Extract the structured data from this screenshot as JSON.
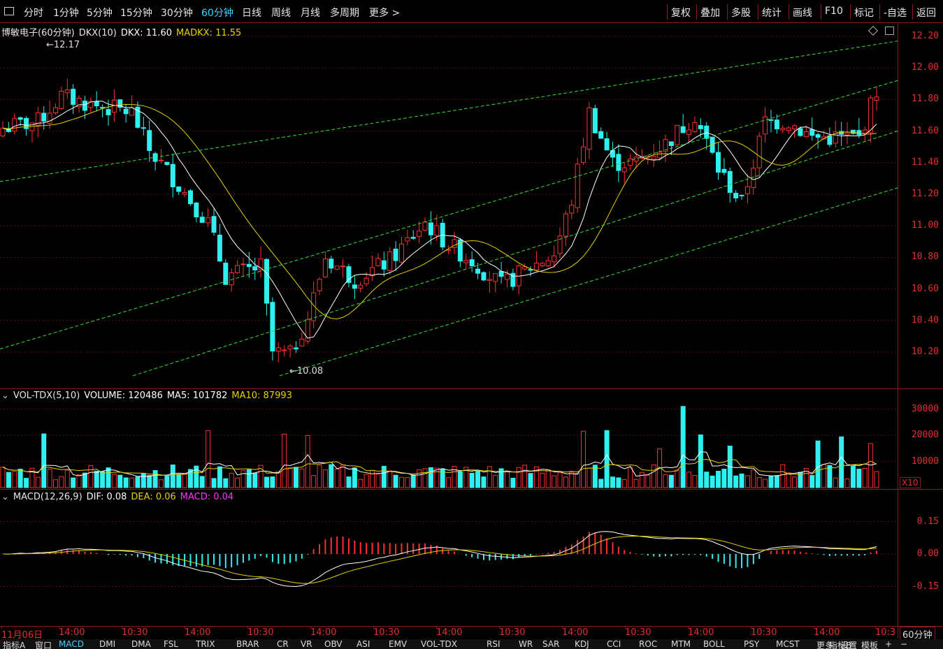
{
  "toolbar": {
    "left_items": [
      "分时",
      "1分钟",
      "5分钟",
      "15分钟",
      "30分钟",
      "60分钟",
      "日线",
      "周线",
      "月线",
      "多周期",
      "更多 >"
    ],
    "active": "60分钟",
    "right_items": [
      "复权",
      "叠加",
      "多股",
      "统计",
      "画线",
      "F10",
      "标记",
      "-自选",
      "返回"
    ]
  },
  "main_panel": {
    "stock_name": "博敏电子(60分钟)",
    "indicator_name": "DKX(10)",
    "dkx_label": "DKX: 11.60",
    "madkx_label": "MADKX: 11.55",
    "high_marker": "12.17",
    "low_marker": "10.08",
    "y_ticks": [
      "12.20",
      "12.00",
      "11.80",
      "11.60",
      "11.40",
      "11.20",
      "11.00",
      "10.80",
      "10.60",
      "10.40",
      "10.20"
    ]
  },
  "volume_panel": {
    "title": "VOL-TDX(5,10)",
    "volume_label": "VOLUME: 120486",
    "ma5_label": "MA5: 101782",
    "ma10_label": "MA10: 87993",
    "y_ticks": [
      "30000",
      "20000",
      "10000"
    ],
    "unit": "X10"
  },
  "macd_panel": {
    "title": "MACD(12,26,9)",
    "dif_label": "DIF: 0.08",
    "dea_label": "DEA: 0.06",
    "macd_label": "MACD: 0.04",
    "y_ticks": [
      "0.15",
      "0.00",
      "-0.15"
    ]
  },
  "time_axis": {
    "labels": [
      "11月06日",
      "14:00",
      "10:30",
      "14:00",
      "10:30",
      "14:00",
      "10:30",
      "14:00",
      "10:30",
      "14:00",
      "10:30",
      "14:00",
      "10:30",
      "14:00",
      "10:3"
    ],
    "period": "60分钟"
  },
  "bottom_tabs": [
    "指标A",
    "窗口",
    "MACD",
    "DMI",
    "DMA",
    "FSL",
    "TRIX",
    "BRAR",
    "CR",
    "VR",
    "OBV",
    "ASI",
    "EMV",
    "VOL-TDX",
    "RSI",
    "WR",
    "SAR",
    "KDJ",
    "CCI",
    "ROC",
    "MTM",
    "BOLL",
    "PSY",
    "MCST",
    "更多",
    "设置",
    "指标B",
    "模板",
    "+",
    "−"
  ],
  "active_tab": "MACD",
  "colors": {
    "up": "#ff3030",
    "down": "#2ff0f0",
    "dkx": "#ffffff",
    "madkx": "#e6d000",
    "channel": "#33dd33",
    "axis": "#8b1a1a"
  },
  "chart_data": {
    "type": "candlestick",
    "series": [
      {
        "name": "DKX",
        "last": 11.6
      },
      {
        "name": "MADKX",
        "last": 11.55
      }
    ],
    "price_range": [
      10.08,
      12.17
    ],
    "volume": {
      "last": 120486,
      "ma5": 101782,
      "ma10": 87993
    },
    "macd": {
      "dif": 0.08,
      "dea": 0.06,
      "macd": 0.04
    }
  }
}
